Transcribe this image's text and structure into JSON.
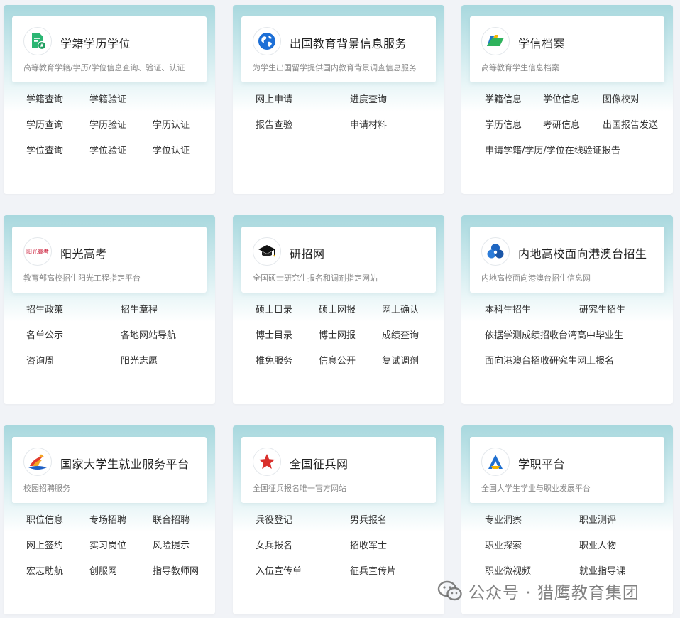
{
  "cards": [
    {
      "title": "学籍学历学位",
      "subtitle": "高等教育学籍/学历/学位信息查询、验证、认证",
      "icon": "green-document-check-icon",
      "links": [
        "学籍查询",
        "学籍验证",
        "",
        "学历查询",
        "学历验证",
        "学历认证",
        "学位查询",
        "学位验证",
        "学位认证"
      ]
    },
    {
      "title": "出国教育背景信息服务",
      "subtitle": "为学生出国留学提供国内教育背景调查信息服务",
      "icon": "blue-globe-icon",
      "links": [
        "网上申请",
        "进度查询",
        "报告查验",
        "申请材料"
      ]
    },
    {
      "title": "学信档案",
      "subtitle": "高等教育学生信息档案",
      "icon": "green-folder-icon",
      "links": [
        "学籍信息",
        "学位信息",
        "图像校对",
        "学历信息",
        "考研信息",
        "出国报告发送",
        "申请学籍/学历/学位在线验证报告"
      ]
    },
    {
      "title": "阳光高考",
      "subtitle": "教育部高校招生阳光工程指定平台",
      "icon": "sunshine-gaokao-logo-icon",
      "logo_text": "阳光高考",
      "links": [
        "招生政策",
        "招生章程",
        "名单公示",
        "各地网站导航",
        "咨询周",
        "阳光志愿"
      ]
    },
    {
      "title": "研招网",
      "subtitle": "全国硕士研究生报名和调剂指定网站",
      "icon": "graduation-cap-icon",
      "links": [
        "硕士目录",
        "硕士网报",
        "网上确认",
        "博士目录",
        "博士网报",
        "成绩查询",
        "推免服务",
        "信息公开",
        "复试调剂"
      ]
    },
    {
      "title": "内地高校面向港澳台招生",
      "subtitle": "内地高校面向港澳台招生信息网",
      "icon": "blue-flower-icon",
      "links": [
        "本科生招生",
        "研究生招生",
        "依据学测成绩招收台湾高中毕业生",
        "面向港澳台招收研究生网上报名"
      ]
    },
    {
      "title": "国家大学生就业服务平台",
      "subtitle": "校园招聘服务",
      "icon": "employment-platform-logo-icon",
      "links": [
        "职位信息",
        "专场招聘",
        "联合招聘",
        "网上签约",
        "实习岗位",
        "风险提示",
        "宏志助航",
        "创服网",
        "指导教师网"
      ]
    },
    {
      "title": "全国征兵网",
      "subtitle": "全国征兵报名唯一官方网站",
      "icon": "red-star-icon",
      "links": [
        "兵役登记",
        "男兵报名",
        "女兵报名",
        "招收军士",
        "入伍宣传单",
        "征兵宣传片"
      ]
    },
    {
      "title": "学职平台",
      "subtitle": "全国大学生学业与职业发展平台",
      "icon": "xuezhi-a-logo-icon",
      "links": [
        "专业洞察",
        "职业测评",
        "职业探索",
        "职业人物",
        "职业微视频",
        "就业指导课"
      ]
    }
  ],
  "watermark": {
    "text": "公众号 · 猎鹰教育集团",
    "icon": "wechat-icon"
  },
  "colors": {
    "header_gradient_top": "#a8d8de",
    "page_background": "#f1f3f7",
    "star_red": "#d9302c",
    "globe_blue": "#1d6fd6"
  }
}
